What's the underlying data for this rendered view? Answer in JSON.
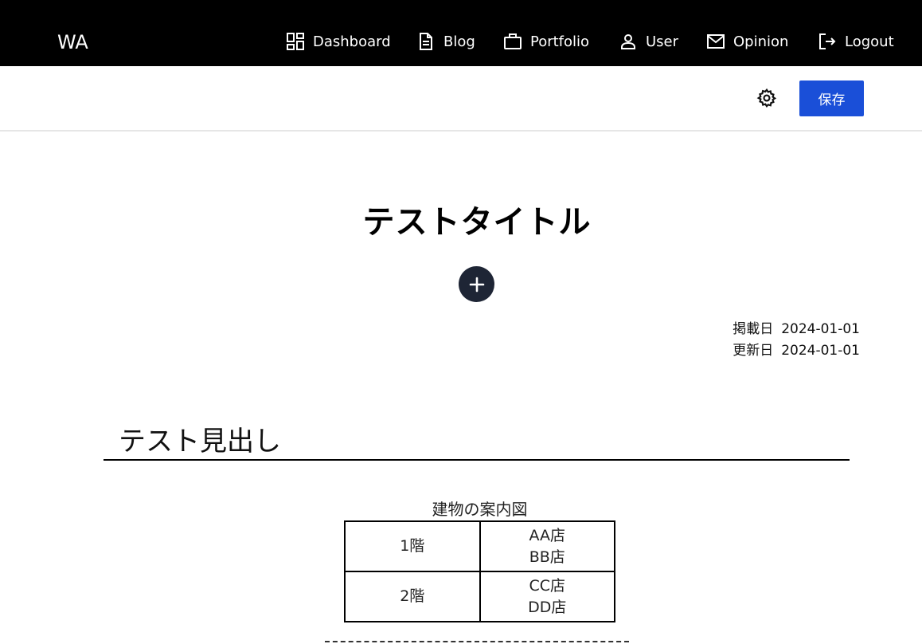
{
  "nav": {
    "logo": "WA",
    "items": [
      {
        "label": "Dashboard",
        "icon": "dashboard-icon"
      },
      {
        "label": "Blog",
        "icon": "document-icon"
      },
      {
        "label": "Portfolio",
        "icon": "briefcase-icon"
      },
      {
        "label": "User",
        "icon": "user-icon"
      },
      {
        "label": "Opinion",
        "icon": "mail-icon"
      },
      {
        "label": "Logout",
        "icon": "logout-icon"
      }
    ]
  },
  "toolbar": {
    "settings_icon": "gear-icon",
    "save_label": "保存",
    "save_color": "#1a4fd8"
  },
  "article": {
    "title": "テストタイトル",
    "add_icon": "plus-icon",
    "published_label": "掲載日",
    "published_date": "2024-01-01",
    "updated_label": "更新日",
    "updated_date": "2024-01-01",
    "heading": "テスト見出し"
  },
  "figure": {
    "caption": "建物の案内図",
    "rows": [
      {
        "floor": "1階",
        "stores": [
          "AA店",
          "BB店"
        ]
      },
      {
        "floor": "2階",
        "stores": [
          "CC店",
          "DD店"
        ]
      }
    ]
  }
}
